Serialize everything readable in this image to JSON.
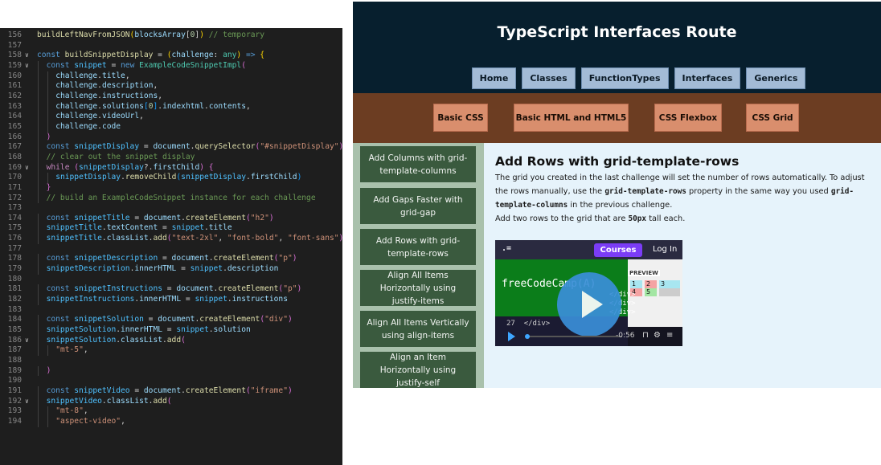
{
  "editor": {
    "lines": [
      {
        "n": "156",
        "fold": "",
        "indent": 0,
        "tokens": [
          [
            "fn",
            "buildLeftNavFromJSON"
          ],
          [
            "br",
            "("
          ],
          [
            "var",
            "blocksArray"
          ],
          [
            "pun",
            "["
          ],
          [
            "num",
            "0"
          ],
          [
            "pun",
            "]"
          ],
          [
            "br",
            ")"
          ],
          [
            "pun",
            " "
          ],
          [
            "com",
            "// temporary"
          ]
        ]
      },
      {
        "n": "157",
        "fold": "",
        "indent": 0,
        "tokens": []
      },
      {
        "n": "158",
        "fold": "v",
        "indent": 0,
        "tokens": [
          [
            "kw",
            "const "
          ],
          [
            "fn",
            "buildSnippetDisplay"
          ],
          [
            "pun",
            " = "
          ],
          [
            "br",
            "("
          ],
          [
            "var",
            "challenge"
          ],
          [
            "pun",
            ": "
          ],
          [
            "cls",
            "any"
          ],
          [
            "br",
            ")"
          ],
          [
            "kw",
            " =>"
          ],
          [
            "pun",
            " "
          ],
          [
            "br",
            "{"
          ]
        ]
      },
      {
        "n": "159",
        "fold": "v",
        "indent": 1,
        "tokens": [
          [
            "kw",
            "const "
          ],
          [
            "const",
            "snippet"
          ],
          [
            "pun",
            " = "
          ],
          [
            "kw",
            "new "
          ],
          [
            "cls",
            "ExampleCodeSnippetImpl"
          ],
          [
            "br2",
            "("
          ]
        ]
      },
      {
        "n": "160",
        "fold": "",
        "indent": 2,
        "tokens": [
          [
            "var",
            "challenge"
          ],
          [
            "pun",
            "."
          ],
          [
            "var",
            "title"
          ],
          [
            "pun",
            ","
          ]
        ]
      },
      {
        "n": "161",
        "fold": "",
        "indent": 2,
        "tokens": [
          [
            "var",
            "challenge"
          ],
          [
            "pun",
            "."
          ],
          [
            "var",
            "description"
          ],
          [
            "pun",
            ","
          ]
        ]
      },
      {
        "n": "162",
        "fold": "",
        "indent": 2,
        "tokens": [
          [
            "var",
            "challenge"
          ],
          [
            "pun",
            "."
          ],
          [
            "var",
            "instructions"
          ],
          [
            "pun",
            ","
          ]
        ]
      },
      {
        "n": "163",
        "fold": "",
        "indent": 2,
        "tokens": [
          [
            "var",
            "challenge"
          ],
          [
            "pun",
            "."
          ],
          [
            "var",
            "solutions"
          ],
          [
            "br3",
            "["
          ],
          [
            "num",
            "0"
          ],
          [
            "br3",
            "]"
          ],
          [
            "pun",
            "."
          ],
          [
            "var",
            "indexhtml"
          ],
          [
            "pun",
            "."
          ],
          [
            "var",
            "contents"
          ],
          [
            "pun",
            ","
          ]
        ]
      },
      {
        "n": "164",
        "fold": "",
        "indent": 2,
        "tokens": [
          [
            "var",
            "challenge"
          ],
          [
            "pun",
            "."
          ],
          [
            "var",
            "videoUrl"
          ],
          [
            "pun",
            ","
          ]
        ]
      },
      {
        "n": "165",
        "fold": "",
        "indent": 2,
        "tokens": [
          [
            "var",
            "challenge"
          ],
          [
            "pun",
            "."
          ],
          [
            "var",
            "code"
          ]
        ]
      },
      {
        "n": "166",
        "fold": "",
        "indent": 1,
        "tokens": [
          [
            "br2",
            ")"
          ]
        ]
      },
      {
        "n": "167",
        "fold": "",
        "indent": 1,
        "tokens": [
          [
            "kw",
            "const "
          ],
          [
            "const",
            "snippetDisplay"
          ],
          [
            "pun",
            " = "
          ],
          [
            "var",
            "document"
          ],
          [
            "pun",
            "."
          ],
          [
            "fn",
            "querySelector"
          ],
          [
            "br2",
            "("
          ],
          [
            "str",
            "\"#snippetDisplay\""
          ],
          [
            "br2",
            ")"
          ]
        ]
      },
      {
        "n": "168",
        "fold": "",
        "indent": 1,
        "tokens": [
          [
            "com",
            "// clear out the snippet display"
          ]
        ]
      },
      {
        "n": "169",
        "fold": "v",
        "indent": 1,
        "tokens": [
          [
            "ctl",
            "while "
          ],
          [
            "br2",
            "("
          ],
          [
            "const",
            "snippetDisplay"
          ],
          [
            "pun",
            "?."
          ],
          [
            "var",
            "firstChild"
          ],
          [
            "br2",
            ")"
          ],
          [
            "pun",
            " "
          ],
          [
            "br2",
            "{"
          ]
        ]
      },
      {
        "n": "170",
        "fold": "",
        "indent": 2,
        "tokens": [
          [
            "const",
            "snippetDisplay"
          ],
          [
            "pun",
            "."
          ],
          [
            "fn",
            "removeChild"
          ],
          [
            "br3",
            "("
          ],
          [
            "const",
            "snippetDisplay"
          ],
          [
            "pun",
            "."
          ],
          [
            "var",
            "firstChild"
          ],
          [
            "br3",
            ")"
          ]
        ]
      },
      {
        "n": "171",
        "fold": "",
        "indent": 1,
        "tokens": [
          [
            "br2",
            "}"
          ]
        ]
      },
      {
        "n": "172",
        "fold": "",
        "indent": 1,
        "tokens": [
          [
            "com",
            "// build an ExampleCodeSnippet instance for each challenge"
          ]
        ]
      },
      {
        "n": "173",
        "fold": "",
        "indent": 0,
        "tokens": []
      },
      {
        "n": "174",
        "fold": "",
        "indent": 1,
        "tokens": [
          [
            "kw",
            "const "
          ],
          [
            "const",
            "snippetTitle"
          ],
          [
            "pun",
            " = "
          ],
          [
            "var",
            "document"
          ],
          [
            "pun",
            "."
          ],
          [
            "fn",
            "createElement"
          ],
          [
            "br2",
            "("
          ],
          [
            "str",
            "\"h2\""
          ],
          [
            "br2",
            ")"
          ]
        ]
      },
      {
        "n": "175",
        "fold": "",
        "indent": 1,
        "tokens": [
          [
            "const",
            "snippetTitle"
          ],
          [
            "pun",
            "."
          ],
          [
            "var",
            "textContent"
          ],
          [
            "pun",
            " = "
          ],
          [
            "const",
            "snippet"
          ],
          [
            "pun",
            "."
          ],
          [
            "var",
            "title"
          ]
        ]
      },
      {
        "n": "176",
        "fold": "",
        "indent": 1,
        "tokens": [
          [
            "const",
            "snippetTitle"
          ],
          [
            "pun",
            "."
          ],
          [
            "var",
            "classList"
          ],
          [
            "pun",
            "."
          ],
          [
            "fn",
            "add"
          ],
          [
            "br2",
            "("
          ],
          [
            "str",
            "\"text-2xl\""
          ],
          [
            "pun",
            ", "
          ],
          [
            "str",
            "\"font-bold\""
          ],
          [
            "pun",
            ", "
          ],
          [
            "str",
            "\"font-sans\""
          ],
          [
            "br2",
            ")"
          ]
        ]
      },
      {
        "n": "177",
        "fold": "",
        "indent": 0,
        "tokens": []
      },
      {
        "n": "178",
        "fold": "",
        "indent": 1,
        "tokens": [
          [
            "kw",
            "const "
          ],
          [
            "const",
            "snippetDescription"
          ],
          [
            "pun",
            " = "
          ],
          [
            "var",
            "document"
          ],
          [
            "pun",
            "."
          ],
          [
            "fn",
            "createElement"
          ],
          [
            "br2",
            "("
          ],
          [
            "str",
            "\"p\""
          ],
          [
            "br2",
            ")"
          ]
        ]
      },
      {
        "n": "179",
        "fold": "",
        "indent": 1,
        "tokens": [
          [
            "const",
            "snippetDescription"
          ],
          [
            "pun",
            "."
          ],
          [
            "var",
            "innerHTML"
          ],
          [
            "pun",
            " = "
          ],
          [
            "const",
            "snippet"
          ],
          [
            "pun",
            "."
          ],
          [
            "var",
            "description"
          ]
        ]
      },
      {
        "n": "180",
        "fold": "",
        "indent": 0,
        "tokens": []
      },
      {
        "n": "181",
        "fold": "",
        "indent": 1,
        "tokens": [
          [
            "kw",
            "const "
          ],
          [
            "const",
            "snippetInstructions"
          ],
          [
            "pun",
            " = "
          ],
          [
            "var",
            "document"
          ],
          [
            "pun",
            "."
          ],
          [
            "fn",
            "createElement"
          ],
          [
            "br2",
            "("
          ],
          [
            "str",
            "\"p\""
          ],
          [
            "br2",
            ")"
          ]
        ]
      },
      {
        "n": "182",
        "fold": "",
        "indent": 1,
        "tokens": [
          [
            "const",
            "snippetInstructions"
          ],
          [
            "pun",
            "."
          ],
          [
            "var",
            "innerHTML"
          ],
          [
            "pun",
            " = "
          ],
          [
            "const",
            "snippet"
          ],
          [
            "pun",
            "."
          ],
          [
            "var",
            "instructions"
          ]
        ]
      },
      {
        "n": "183",
        "fold": "",
        "indent": 0,
        "tokens": []
      },
      {
        "n": "184",
        "fold": "",
        "indent": 1,
        "tokens": [
          [
            "kw",
            "const "
          ],
          [
            "const",
            "snippetSolution"
          ],
          [
            "pun",
            " = "
          ],
          [
            "var",
            "document"
          ],
          [
            "pun",
            "."
          ],
          [
            "fn",
            "createElement"
          ],
          [
            "br2",
            "("
          ],
          [
            "str",
            "\"div\""
          ],
          [
            "br2",
            ")"
          ]
        ]
      },
      {
        "n": "185",
        "fold": "",
        "indent": 1,
        "tokens": [
          [
            "const",
            "snippetSolution"
          ],
          [
            "pun",
            "."
          ],
          [
            "var",
            "innerHTML"
          ],
          [
            "pun",
            " = "
          ],
          [
            "const",
            "snippet"
          ],
          [
            "pun",
            "."
          ],
          [
            "var",
            "solution"
          ]
        ]
      },
      {
        "n": "186",
        "fold": "v",
        "indent": 1,
        "tokens": [
          [
            "const",
            "snippetSolution"
          ],
          [
            "pun",
            "."
          ],
          [
            "var",
            "classList"
          ],
          [
            "pun",
            "."
          ],
          [
            "fn",
            "add"
          ],
          [
            "br2",
            "("
          ]
        ]
      },
      {
        "n": "187",
        "fold": "",
        "indent": 2,
        "tokens": [
          [
            "str",
            "\"mt-5\""
          ],
          [
            "pun",
            ","
          ]
        ]
      },
      {
        "n": "188",
        "fold": "",
        "indent": 0,
        "tokens": []
      },
      {
        "n": "189",
        "fold": "",
        "indent": 1,
        "tokens": [
          [
            "br2",
            ")"
          ]
        ]
      },
      {
        "n": "190",
        "fold": "",
        "indent": 0,
        "tokens": []
      },
      {
        "n": "191",
        "fold": "",
        "indent": 1,
        "tokens": [
          [
            "kw",
            "const "
          ],
          [
            "const",
            "snippetVideo"
          ],
          [
            "pun",
            " = "
          ],
          [
            "var",
            "document"
          ],
          [
            "pun",
            "."
          ],
          [
            "fn",
            "createElement"
          ],
          [
            "br2",
            "("
          ],
          [
            "str",
            "\"iframe\""
          ],
          [
            "br2",
            ")"
          ]
        ]
      },
      {
        "n": "192",
        "fold": "v",
        "indent": 1,
        "tokens": [
          [
            "const",
            "snippetVideo"
          ],
          [
            "pun",
            "."
          ],
          [
            "var",
            "classList"
          ],
          [
            "pun",
            "."
          ],
          [
            "fn",
            "add"
          ],
          [
            "br2",
            "("
          ]
        ]
      },
      {
        "n": "193",
        "fold": "",
        "indent": 2,
        "tokens": [
          [
            "str",
            "\"mt-8\""
          ],
          [
            "pun",
            ","
          ]
        ]
      },
      {
        "n": "194",
        "fold": "",
        "indent": 2,
        "tokens": [
          [
            "str",
            "\"aspect-video\""
          ],
          [
            "pun",
            ","
          ]
        ]
      }
    ]
  },
  "site": {
    "title": "TypeScript Interfaces Route",
    "top_nav": [
      "Home",
      "Classes",
      "FunctionTypes",
      "Interfaces",
      "Generics"
    ],
    "sub_nav": [
      "Basic CSS",
      "Basic HTML and HTML5",
      "CSS Flexbox",
      "CSS Grid"
    ],
    "left_nav": [
      "Add Columns with grid-template-columns",
      "Add Gaps Faster with grid-gap",
      "Add Rows with grid-template-rows",
      "Align All Items Horizontally using justify-items",
      "Align All Items Vertically using align-items",
      "Align an Item Horizontally using justify-self"
    ],
    "challenge": {
      "title": "Add Rows with grid-template-rows",
      "desc_1": "The grid you created in the last challenge will set the number of rows automatically. To adjust the rows manually, use the ",
      "desc_code_1": "grid-template-rows",
      "desc_2": " property in the same way you used ",
      "desc_code_2": "grid-template-columns",
      "desc_3": " in the previous challenge.",
      "instr_1": "Add two rows to the grid that are ",
      "instr_code": "50px",
      "instr_2": " tall each."
    },
    "video": {
      "logo": ".=",
      "courses": "Courses",
      "login": "Log In",
      "brand": "freeCodeCamp(A)",
      "preview": "PREVIEW",
      "grid": [
        "1",
        "2",
        "3",
        "4",
        "5"
      ],
      "code_line_num": "27",
      "code_line": "</div>",
      "inner_code": "</div>\n</div>\n</div>",
      "time": "-0:56"
    }
  },
  "colors": {
    "editor_bg": "#1e1e1e",
    "site_header": "#071f2e",
    "sub_header": "#6c3d22",
    "left_nav_bg": "#a9c1ac",
    "left_item": "#3a5a3e",
    "main_bg": "#e6f3fb"
  }
}
